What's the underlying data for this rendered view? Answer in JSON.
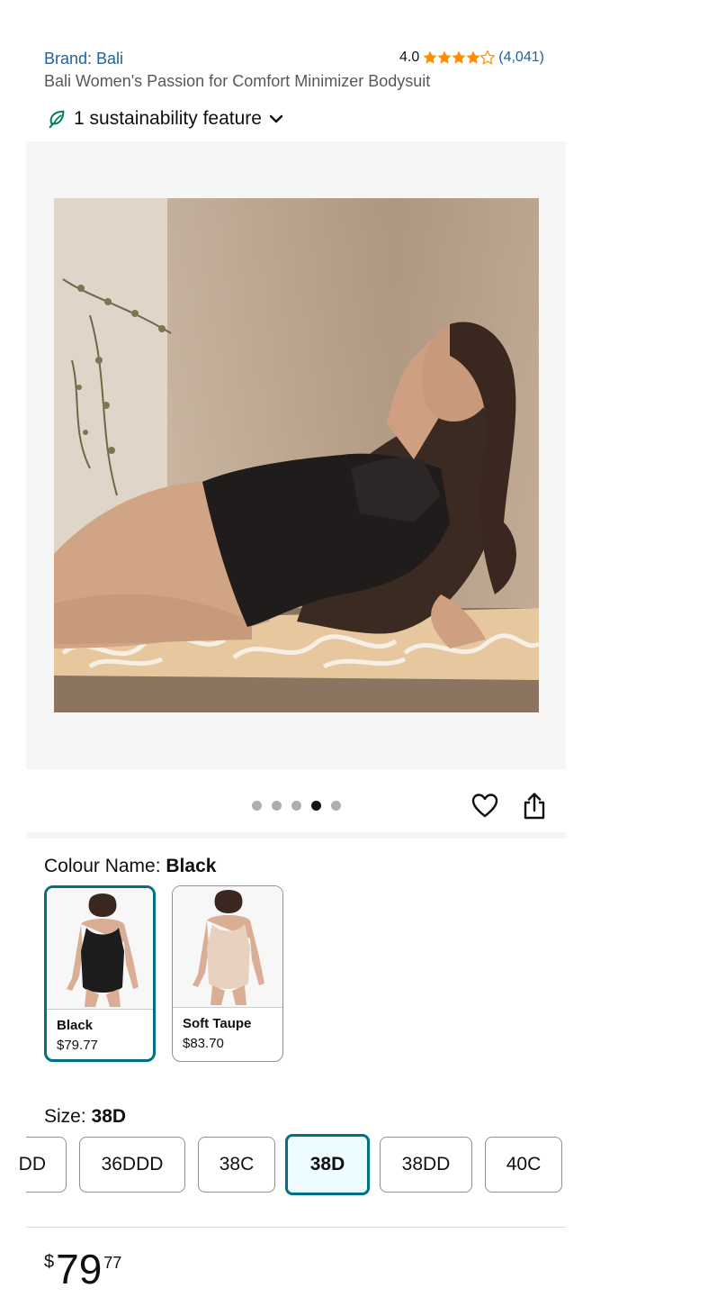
{
  "header": {
    "brand_label": "Brand: Bali",
    "rating_value": "4.0",
    "rating_stars": 4,
    "rating_count": "(4,041)",
    "product_title": "Bali Women's Passion for Comfort Minimizer Bodysuit",
    "sustainability_label": "1 sustainability feature"
  },
  "gallery": {
    "image_count": 5,
    "active_index": 3
  },
  "colour": {
    "label": "Colour Name: ",
    "selected": "Black",
    "options": [
      {
        "name": "Black",
        "price": "$79.77",
        "selected": true
      },
      {
        "name": "Soft Taupe",
        "price": "$83.70",
        "selected": false
      }
    ]
  },
  "size": {
    "label": "Size: ",
    "selected": "38D",
    "options": [
      "DD",
      "36DDD",
      "38C",
      "38D",
      "38DD",
      "40C"
    ]
  },
  "price": {
    "symbol": "$",
    "whole": "79",
    "fraction": "77"
  },
  "colors": {
    "accent": "#007185",
    "link": "#2162a1",
    "star": "#ff8f00"
  }
}
